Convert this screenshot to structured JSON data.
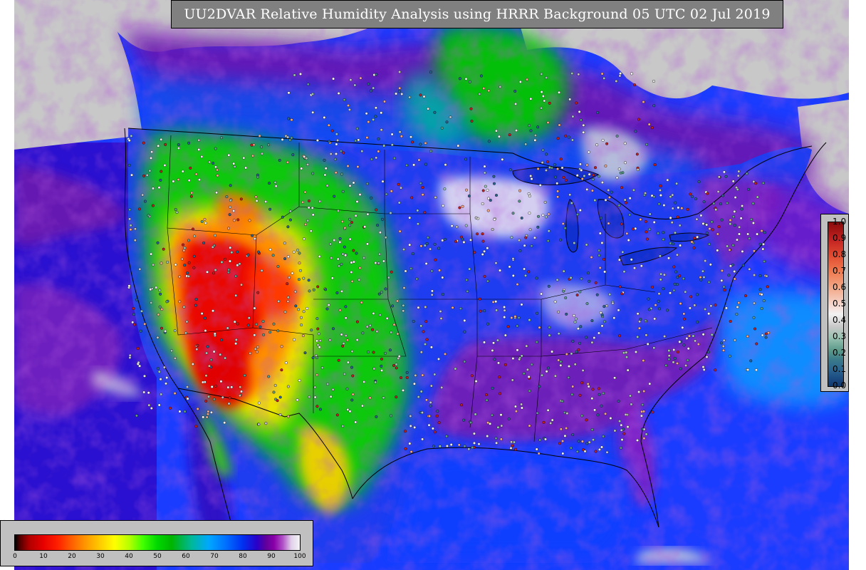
{
  "title": "UU2DVAR Relative Humidity Analysis using HRRR Background 05 UTC 02 Jul 2019",
  "rh_colorbar": {
    "ticks": [
      "0",
      "10",
      "20",
      "30",
      "40",
      "50",
      "60",
      "70",
      "80",
      "90",
      "100"
    ],
    "min": 0,
    "max": 100
  },
  "increment_colorbar": {
    "ticks": [
      "1.0",
      "0.9",
      "0.8",
      "0.7",
      "0.6",
      "0.5",
      "0.4",
      "0.3",
      "0.2",
      "0.1",
      "0.0"
    ],
    "min": 0.0,
    "max": 1.0
  },
  "colors": {
    "background_land_missing": "#c8c8c8",
    "title_bg": "#808080",
    "legend_bg": "#c0c0c0",
    "ocean_moist": "#1a3cff",
    "dry_core": "#e80000",
    "borders": "#000000"
  },
  "map": {
    "region": "CONUS",
    "projection": "lambert-conformal",
    "field": "relative humidity",
    "observation_markers": "station-dots"
  }
}
